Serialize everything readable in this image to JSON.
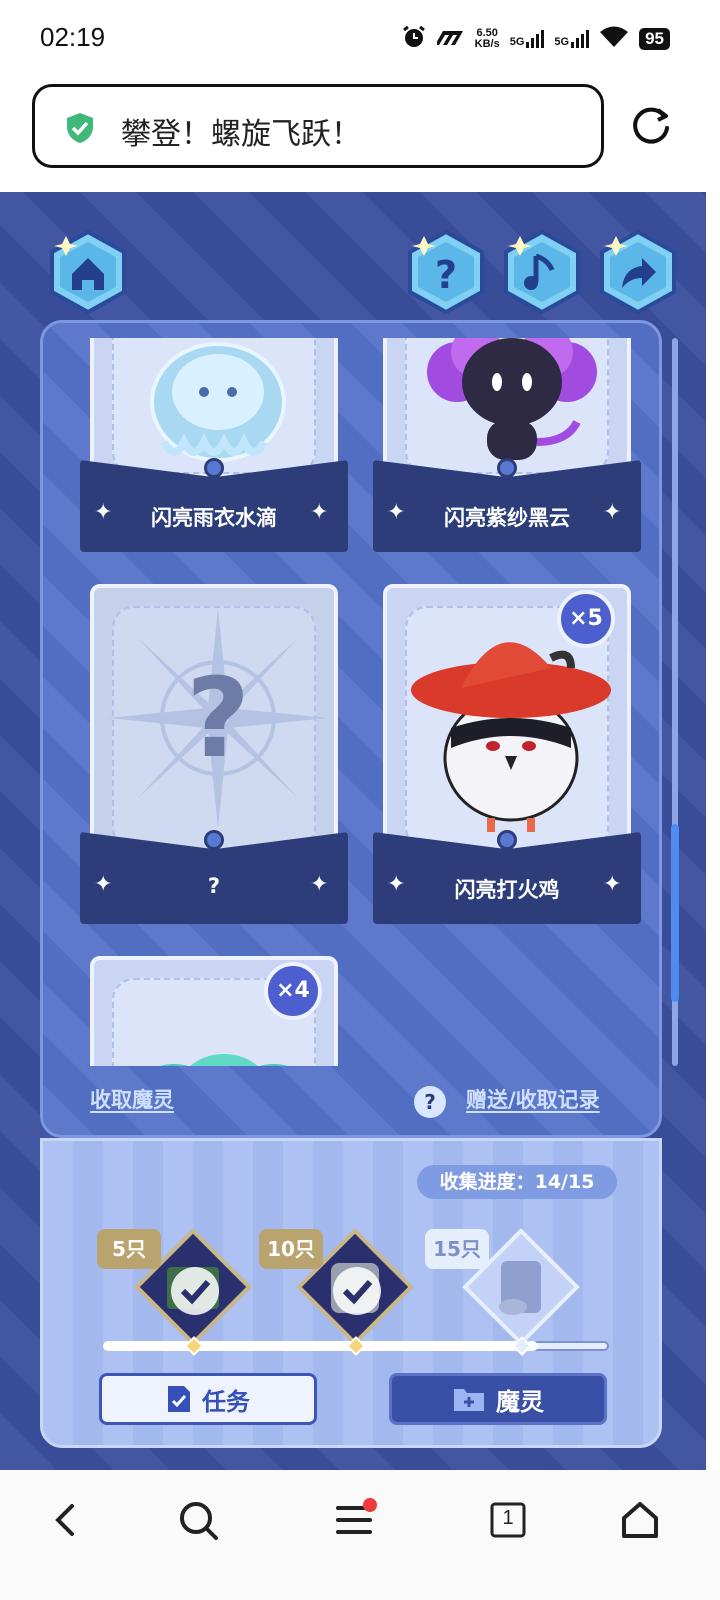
{
  "status_bar": {
    "time": "02:19",
    "net_speed_value": "6.50",
    "net_speed_unit": "KB/s",
    "signal1": "5G",
    "signal2": "5G",
    "battery": "95"
  },
  "address_bar": {
    "title": "攀登！螺旋飞跃！"
  },
  "cards": [
    {
      "name": "闪亮雨衣水滴"
    },
    {
      "name": "闪亮紫纱黑云"
    },
    {
      "name": "?"
    },
    {
      "name": "闪亮打火鸡",
      "count": "×5"
    },
    {
      "count": "×4"
    }
  ],
  "links": {
    "collect": "收取魔灵",
    "records": "赠送/收取记录",
    "help_icon": "?"
  },
  "collection": {
    "progress_label": "收集进度：",
    "progress_value": "14/15",
    "progress_fraction": 0.86,
    "milestones": [
      {
        "tag": "5只",
        "claimed": true
      },
      {
        "tag": "10只",
        "claimed": true
      },
      {
        "tag": "15只",
        "claimed": false
      }
    ]
  },
  "buttons": {
    "task": "任务",
    "spirit": "魔灵"
  },
  "nav": {
    "tab_count": "1"
  },
  "colors": {
    "game_bg": "#3a4f9e",
    "panel": "#5572c8",
    "plate": "#2d3d7a",
    "accent_green": "#3fb87a",
    "badge_blue": "#4d5fcf"
  }
}
